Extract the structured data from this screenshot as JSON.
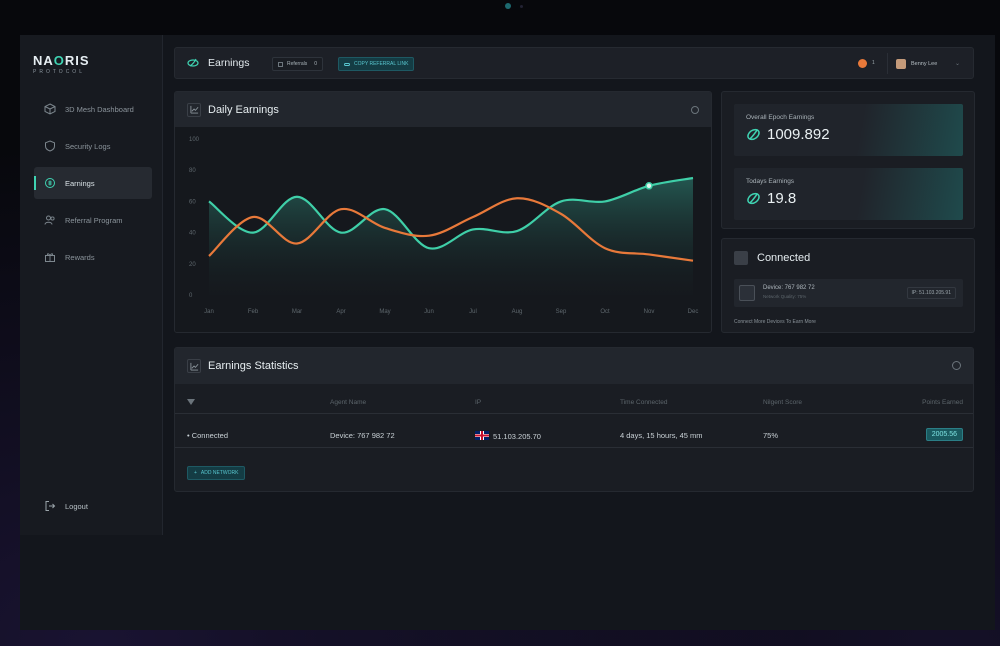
{
  "brand": {
    "name_a": "NA",
    "name_b": "O",
    "name_c": "RIS",
    "tagline": "PROTOCOL"
  },
  "sidebar": {
    "items": [
      {
        "label": "3D Mesh Dashboard",
        "icon": "cube-icon"
      },
      {
        "label": "Security Logs",
        "icon": "shield-icon"
      },
      {
        "label": "Earnings",
        "icon": "earnings-icon",
        "active": true
      },
      {
        "label": "Referral Program",
        "icon": "users-icon"
      },
      {
        "label": "Rewards",
        "icon": "gift-icon"
      }
    ],
    "logout": "Logout"
  },
  "header": {
    "title": "Earnings",
    "referrals_label": "Referrals",
    "referrals_count": "0",
    "copy_label": "COPY REFERRAL LINK",
    "notifications": "1",
    "user_name": "Benny Lee"
  },
  "daily": {
    "title": "Daily Earnings"
  },
  "chart_data": {
    "type": "line",
    "title": "Daily Earnings",
    "categories": [
      "Jan",
      "Feb",
      "Mar",
      "Apr",
      "May",
      "Jun",
      "Jul",
      "Aug",
      "Sep",
      "Oct",
      "Nov",
      "Dec"
    ],
    "y_ticks": [
      0,
      20,
      40,
      60,
      80,
      100
    ],
    "ylim": [
      0,
      100
    ],
    "series": [
      {
        "color": "#3fcfa8",
        "values": [
          60,
          40,
          63,
          40,
          55,
          30,
          42,
          41,
          60,
          60,
          70,
          75
        ]
      },
      {
        "color": "#e8793a",
        "values": [
          25,
          50,
          33,
          55,
          43,
          38,
          50,
          62,
          52,
          30,
          26,
          22
        ]
      }
    ],
    "highlight": {
      "series": 0,
      "index": 10
    },
    "grid": false
  },
  "stats": {
    "epoch_label": "Overall Epoch Earnings",
    "epoch_value": "1009.892",
    "today_label": "Todays Earnings",
    "today_value": "19.8"
  },
  "connected": {
    "title": "Connected",
    "device_name": "Device: 767 982 72",
    "device_sub": "Network Quality: 75%",
    "device_ip": "IP: 51.103.205.91",
    "link": "Connect More Devices To Earn More"
  },
  "earnings_stats": {
    "title": "Earnings Statistics",
    "columns": [
      "Agent Name",
      "IP",
      "Time Connected",
      "Nilgent Score",
      "Points Earned"
    ],
    "row": {
      "status": "Connected",
      "agent": "Device: 767 982 72",
      "ip": "51.103.205.70",
      "time": "4 days, 15 hours, 45 mm",
      "score": "75%",
      "points": "2005.56"
    },
    "add_label": "ADD NETWORK"
  },
  "colors": {
    "accent": "#3fd3b2",
    "orange": "#e8793a",
    "bg": "#13161c"
  }
}
